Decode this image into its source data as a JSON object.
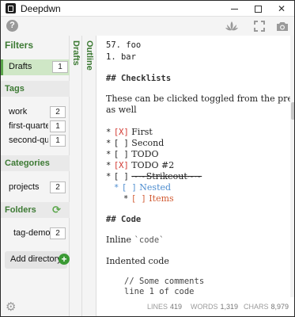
{
  "window": {
    "title": "Deepdwn"
  },
  "sidebar": {
    "title": "Filters",
    "drafts": {
      "label": "Drafts",
      "count": "1"
    },
    "tags_header": "Tags",
    "tags": [
      {
        "label": "work",
        "count": "2"
      },
      {
        "label": "first-quarter",
        "count": "1"
      },
      {
        "label": "second-qu...",
        "count": "1"
      }
    ],
    "categories_header": "Categories",
    "categories": [
      {
        "label": "projects",
        "count": "2"
      }
    ],
    "folders_header": "Folders",
    "folders": [
      {
        "label": "tag-demo",
        "count": "2"
      }
    ],
    "add_directory": "Add directory"
  },
  "tabs": {
    "drafts": "Drafts",
    "outline": "Outline"
  },
  "editor": {
    "line1": "57. foo",
    "line2": "1.  bar",
    "checklists_heading": "## Checklists",
    "paragraph_line1": "These can be clicked toggled from the preview panel",
    "paragraph_line2": "as well",
    "checklist": [
      {
        "bullet": "*",
        "box": "[X]",
        "text": "First"
      },
      {
        "bullet": "*",
        "box": "[ ]",
        "text": "Second"
      },
      {
        "bullet": "*",
        "box": "[ ]",
        "text": "TODO"
      },
      {
        "bullet": "*",
        "box": "[X]",
        "text": "TODO #2"
      },
      {
        "bullet": "*",
        "box": "[ ]",
        "text": "~~Strikeout~~"
      },
      {
        "bullet": "*",
        "box": "[ ]",
        "text": "Nested"
      },
      {
        "bullet": "*",
        "box": "[ ]",
        "text": "Items"
      }
    ],
    "code_heading": "## Code",
    "inline_label": "Inline",
    "inline_code": "`code`",
    "indented_label": "Indented code",
    "code_line1": "// Some comments",
    "code_line2": "line 1 of code"
  },
  "status": {
    "lines_label": "LINES",
    "lines_value": "419",
    "words_label": "WORDS",
    "words_value": "1,319",
    "chars_label": "CHARS",
    "chars_value": "8,979"
  },
  "colors": {
    "accent_green": "#3d7a34",
    "active_bg": "#cfe7c6",
    "check_red": "#d0342c",
    "nested_blue": "#4c8ccf",
    "items_orange": "#d15a32"
  },
  "icons": [
    "app-icon",
    "help-icon",
    "lotus-icon",
    "expand-icon",
    "camera-icon",
    "refresh-icon",
    "add-icon",
    "gear-icon"
  ]
}
